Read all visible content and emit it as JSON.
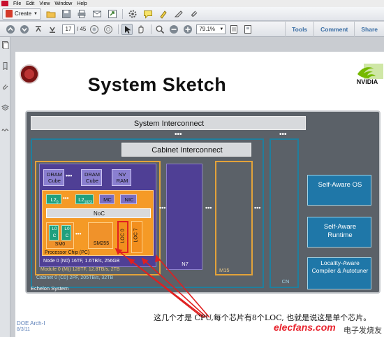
{
  "menu": {
    "items": [
      "File",
      "Edit",
      "View",
      "Window",
      "Help"
    ]
  },
  "toolbar": {
    "create_label": "Create",
    "icons": [
      "open-folder-icon",
      "save-icon",
      "print-icon",
      "email-icon",
      "share-icon",
      "settings-icon",
      "comment-icon",
      "highlight-icon",
      "sign-icon",
      "attach-icon"
    ]
  },
  "nav": {
    "page_current": "17",
    "page_total": "/ 45",
    "zoom": "79.1%",
    "links": [
      "Tools",
      "Comment",
      "Share"
    ]
  },
  "slide": {
    "title": "System Sketch",
    "footer_source": "DOE Arch-I",
    "footer_date": "8/3/11",
    "annotation": "这几个才是 CPU,每个芯片有8个LOC, 也就是说这是单个芯片。",
    "watermark_red": "电子发烧友",
    "watermark_site": "elecfans.com"
  },
  "diagram": {
    "system_interconnect": "System Interconnect",
    "cabinet_interconnect": "Cabinet Interconnect",
    "dram1": "DRAM Cube",
    "dram2": "DRAM Cube",
    "nvram": "NV RAM",
    "l2_0": "L2",
    "l2_0_sub": "0",
    "l2_1": "L2",
    "l2_1_sub": "1023",
    "mc": "MC",
    "nic": "NIC",
    "noc": "NoC",
    "l0_a": "L0",
    "c0_a": "C",
    "l0_b": "L0",
    "c0_b": "C",
    "sm0": "SM0",
    "sm255": "SM255",
    "loc0": "LOC 0",
    "loc7": "LOC 7",
    "processor_chip": "Processor Chip (PC)",
    "node0": "Node 0 (N0) 16TF, 1.6TB/s, 256GB",
    "module0": "Module 0 (M)) 128TF, 12.8TB/s, 2TB",
    "cabinet0": "Cabinet 0 (C0) 2PF, 205TB/s, 32TB",
    "echelon": "Echelon System",
    "n7": "N7",
    "m15": "M15",
    "cn": "CN",
    "os": "Self-Aware OS",
    "runtime": "Self-Aware Runtime",
    "compiler": "Locality-Aware Compiler & Autotuner",
    "accent_orange": "#f7941d",
    "accent_purple": "#5c4fa8",
    "accent_teal": "#1f7f9e"
  }
}
